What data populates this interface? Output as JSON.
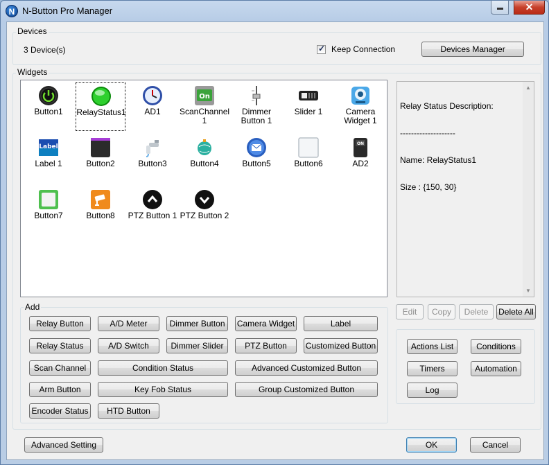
{
  "window": {
    "title": "N-Button Pro Manager",
    "logo_letter": "N",
    "close_glyph": "✕"
  },
  "devices": {
    "group_label": "Devices",
    "count_text": "3 Device(s)",
    "keep_connection_label": "Keep Connection",
    "keep_connection_checked": true,
    "check_glyph": "✓",
    "manager_button": "Devices Manager"
  },
  "widgets": {
    "group_label": "Widgets",
    "items": [
      {
        "label": "Button1",
        "icon": "power-button-icon"
      },
      {
        "label": "RelayStatus1",
        "icon": "green-led-icon",
        "selected": true
      },
      {
        "label": "AD1",
        "icon": "clock-gauge-icon"
      },
      {
        "label": "ScanChannel\n1",
        "icon": "on-switch-icon",
        "label_glyph": "On"
      },
      {
        "label": "Dimmer\nButton 1",
        "icon": "dimmer-fader-icon"
      },
      {
        "label": "Slider 1",
        "icon": "slider-icon"
      },
      {
        "label": "Camera\nWidget 1",
        "icon": "webcam-icon"
      },
      {
        "label": "Label 1",
        "icon": "label-icon",
        "label_glyph": "Label"
      },
      {
        "label": "Button2",
        "icon": "dark-panel-icon"
      },
      {
        "label": "Button3",
        "icon": "faucet-icon"
      },
      {
        "label": "Button4",
        "icon": "globe-icon"
      },
      {
        "label": "Button5",
        "icon": "mail-icon"
      },
      {
        "label": "Button6",
        "icon": "blank-square-icon"
      },
      {
        "label": "AD2",
        "icon": "toggle-on-icon",
        "label_glyph": "ON"
      },
      {
        "label": "Button7",
        "icon": "green-frame-icon"
      },
      {
        "label": "Button8",
        "icon": "cctv-camera-icon"
      },
      {
        "label": "PTZ Button 1",
        "icon": "chevron-up-icon"
      },
      {
        "label": "PTZ Button 2",
        "icon": "chevron-down-icon"
      }
    ]
  },
  "description": {
    "title": "Relay Status Description:",
    "divider": "--------------------",
    "name_line": "Name: RelayStatus1",
    "size_line": "Size : {150, 30}",
    "scroll_up": "▲",
    "scroll_down": "▼"
  },
  "edit_buttons": {
    "edit": "Edit",
    "copy": "Copy",
    "delete": "Delete",
    "delete_all": "Delete All"
  },
  "add": {
    "group_label": "Add",
    "relay_button": "Relay Button",
    "ad_meter": "A/D Meter",
    "dimmer_button": "Dimmer Button",
    "camera_widget": "Camera Widget",
    "label": "Label",
    "relay_status": "Relay Status",
    "ad_switch": "A/D Switch",
    "dimmer_slider": "Dimmer Slider",
    "ptz_button": "PTZ Button",
    "customized_button": "Customized Button",
    "scan_channel": "Scan Channel",
    "condition_status": "Condition Status",
    "advanced_customized_button": "Advanced Customized Button",
    "arm_button": "Arm Button",
    "key_fob_status": "Key Fob Status",
    "group_customized_button": "Group Customized Button",
    "encoder_status": "Encoder Status",
    "htd_button": "HTD Button"
  },
  "actions": {
    "actions_list": "Actions List",
    "conditions": "Conditions",
    "timers": "Timers",
    "automation": "Automation",
    "log": "Log"
  },
  "footer": {
    "advanced_setting": "Advanced Setting",
    "ok": "OK",
    "cancel": "Cancel"
  }
}
